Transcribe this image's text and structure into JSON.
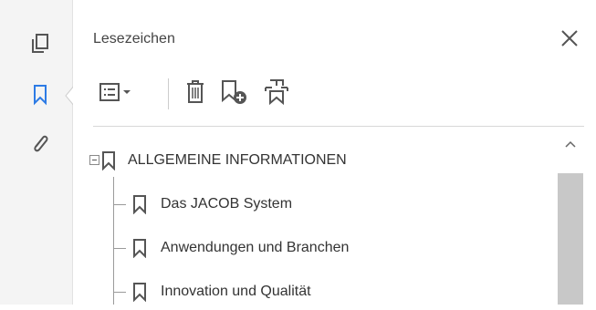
{
  "rail": {
    "items": [
      {
        "name": "pages",
        "icon": "pages-icon"
      },
      {
        "name": "bookmarks",
        "icon": "bookmark-icon",
        "active": true
      },
      {
        "name": "attachments",
        "icon": "paperclip-icon"
      }
    ],
    "accent_color": "#2d7be5"
  },
  "panel": {
    "title": "Lesezeichen",
    "close_icon": "close-icon"
  },
  "toolbar": {
    "items": [
      {
        "name": "options-menu",
        "icon": "list-options-icon"
      },
      {
        "name": "delete",
        "icon": "trash-icon"
      },
      {
        "name": "new-bookmark",
        "icon": "bookmark-add-icon"
      },
      {
        "name": "expand-current",
        "icon": "bookmark-expand-icon"
      }
    ]
  },
  "bookmarks": {
    "root": {
      "label": "ALLGEMEINE INFORMATIONEN",
      "expanded": true
    },
    "children": [
      {
        "label": "Das JACOB System"
      },
      {
        "label": "Anwendungen und Branchen"
      },
      {
        "label": "Innovation und Qualität"
      }
    ]
  }
}
